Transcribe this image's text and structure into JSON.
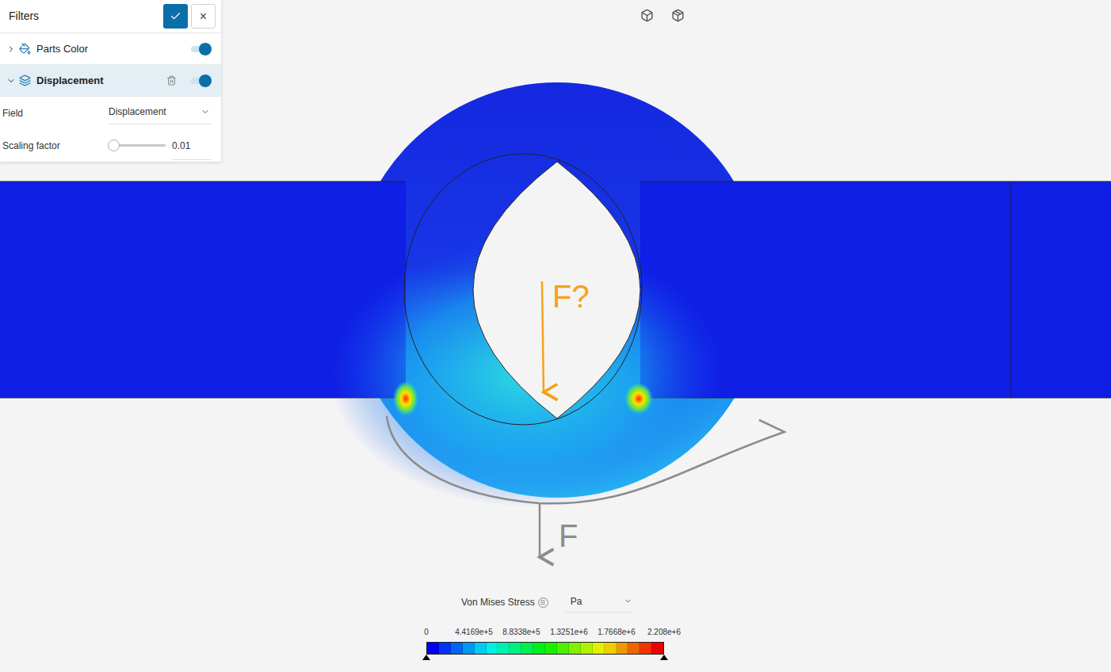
{
  "filters": {
    "title": "Filters",
    "close": "×",
    "layers": [
      {
        "label": "Parts Color",
        "expanded": false,
        "selected": false,
        "on": true
      },
      {
        "label": "Displacement",
        "expanded": true,
        "selected": true,
        "on": true
      }
    ],
    "settings": [
      {
        "kind": "dropdown",
        "label": "Field",
        "value": "Displacement"
      },
      {
        "kind": "slider",
        "label": "Scaling factor",
        "level": 0,
        "value": "0.01"
      }
    ]
  },
  "annotations": [
    {
      "label": "F?",
      "color": "#f5a21b"
    },
    {
      "label": "F",
      "color": "#8c8c8c"
    }
  ],
  "legend": {
    "title": "Von Mises Stress",
    "unit": "Pa",
    "ticks": [
      "0",
      "4.4169e+5",
      "8.8338e+5",
      "1.3251e+6",
      "1.7668e+6",
      "2.208e+6"
    ]
  }
}
